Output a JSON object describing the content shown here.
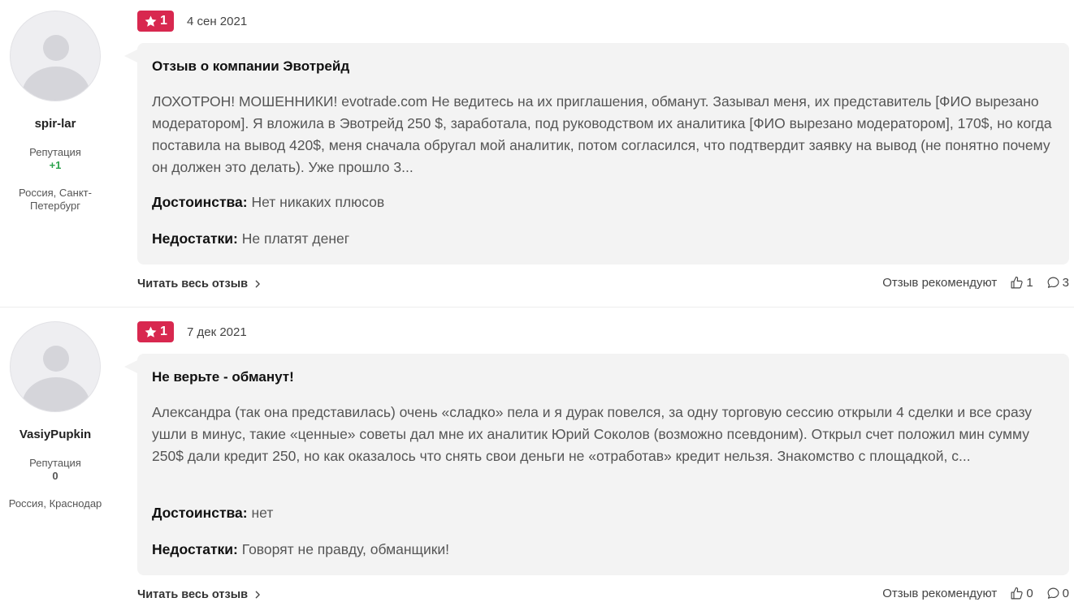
{
  "reviews": [
    {
      "author": {
        "username": "spir-lar",
        "reputation_label": "Репутация",
        "reputation_value": "+1",
        "location": "Россия, Санкт-Петербург"
      },
      "rating": "1",
      "date": "4 сен 2021",
      "title": "Отзыв о компании Эвотрейд",
      "text": "ЛОХОТРОН! МОШЕННИКИ! evotrade.com Не ведитесь на их приглашения, обманут. Зазывал меня, их представитель [ФИО вырезано модератором]. Я вложила в Эвотрейд 250 $, заработала, под руководством их аналитика [ФИО вырезано модератором], 170$, но когда поставила на вывод 420$, меня сначала обругал мой аналитик, потом согласился, что подтвердит заявку на вывод (не понятно почему он должен это делать). Уже прошло 3...",
      "pros_label": "Достоинства:",
      "pros": "Нет никаких плюсов",
      "cons_label": "Недостатки:",
      "cons": "Не платят денег",
      "read_more": "Читать весь отзыв",
      "recommend_label": "Отзыв рекомендуют",
      "likes": "1",
      "comments": "3"
    },
    {
      "author": {
        "username": "VasiyPupkin",
        "reputation_label": "Репутация",
        "reputation_value": "0",
        "location": "Россия, Краснодар"
      },
      "rating": "1",
      "date": "7 дек 2021",
      "title": "Не верьте - обманут!",
      "text": "Александра (так она представилась) очень «сладко» пела и я дурак повелся, за одну торговую сессию открыли 4 сделки и все сразу ушли в минус, такие «ценные» советы дал мне их аналитик Юрий Соколов (возможно псевдоним). Открыл счет положил мин сумму 250$ дали кредит 250, но как оказалось что снять свои деньги не «отработав» кредит нельзя. Знакомство с площадкой, с...",
      "pros_label": "Достоинства:",
      "pros": "нет",
      "cons_label": "Недостатки:",
      "cons": "Говорят не правду, обманщики!",
      "read_more": "Читать весь отзыв",
      "recommend_label": "Отзыв рекомендуют",
      "likes": "0",
      "comments": "0"
    }
  ],
  "colors": {
    "rating_badge": "#d8284f",
    "positive_reputation": "#2ba24c",
    "card_background": "#f3f3f3"
  },
  "icons": [
    "star-icon",
    "chevron-right-icon",
    "thumbs-up-icon",
    "comment-icon"
  ]
}
